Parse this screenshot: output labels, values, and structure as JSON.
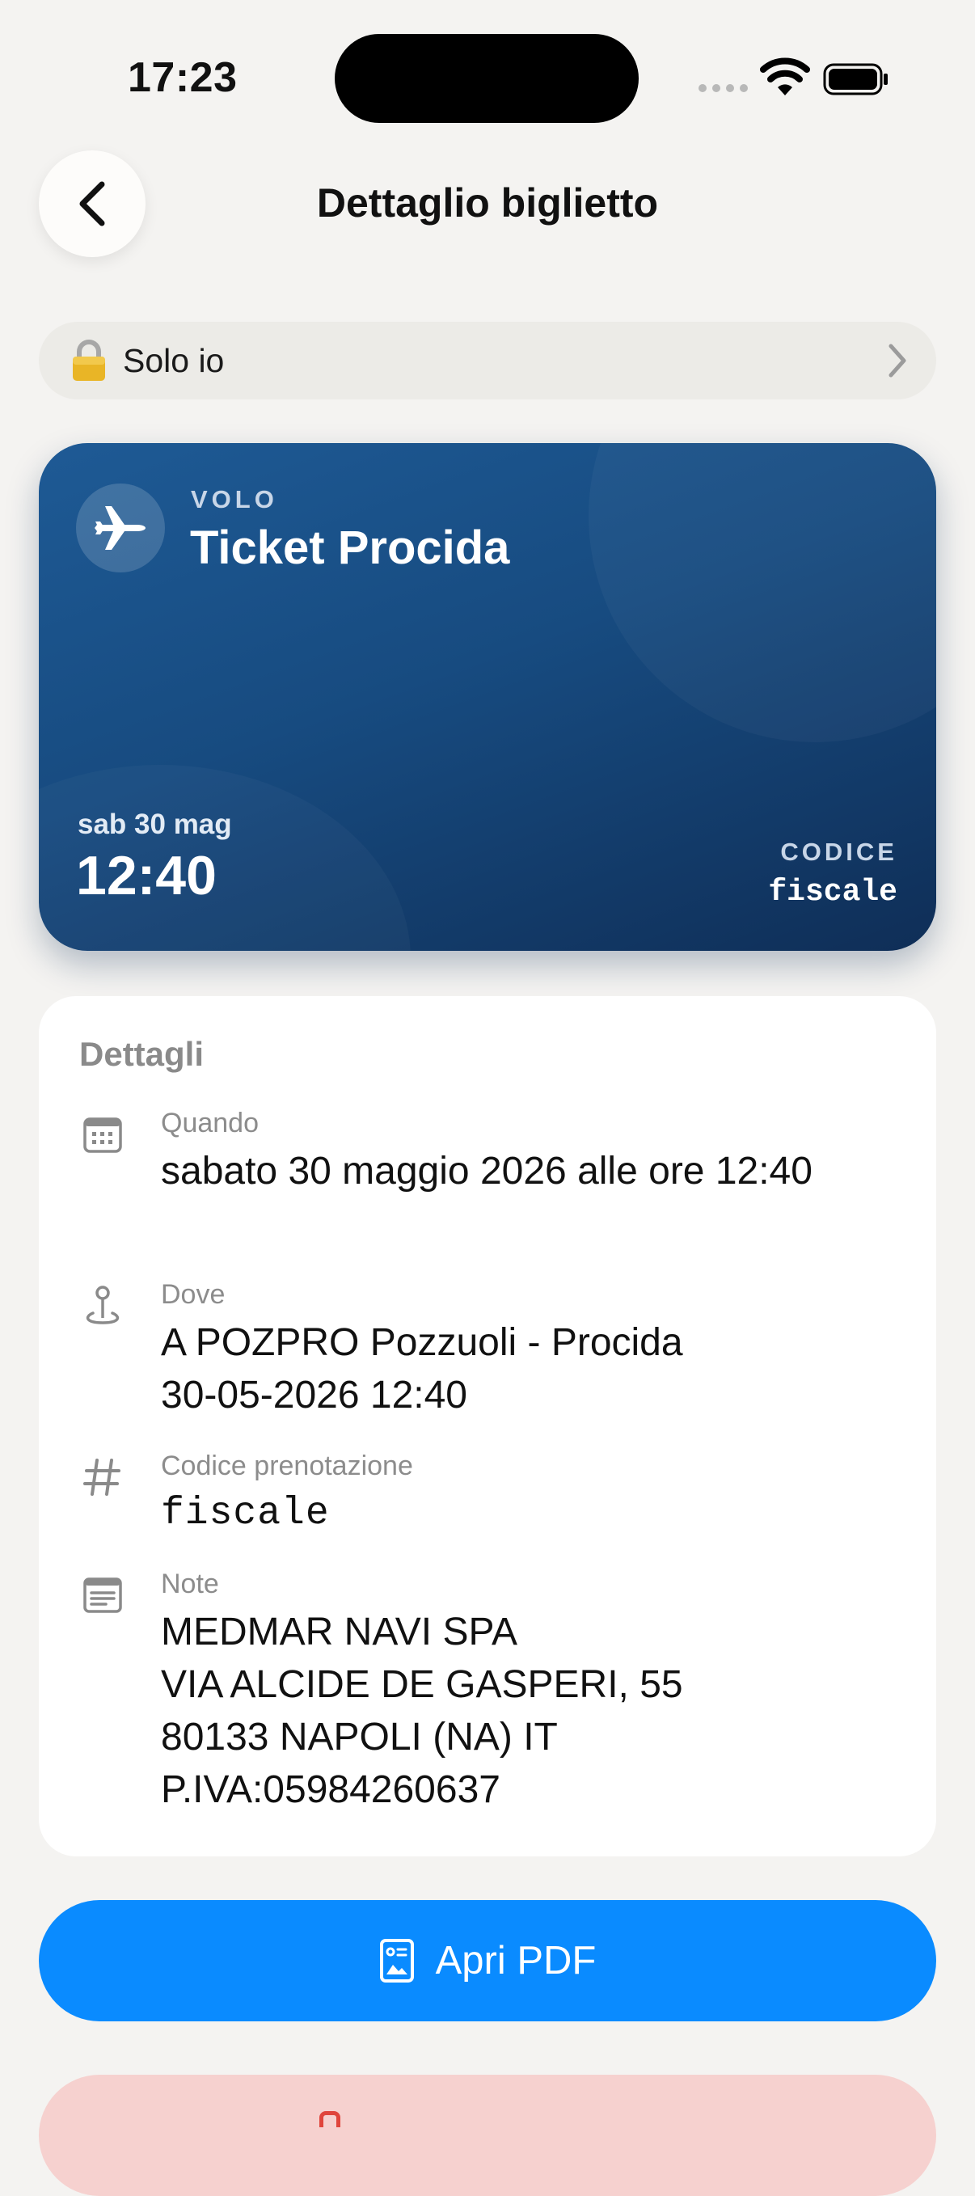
{
  "status_bar": {
    "time": "17:23"
  },
  "header": {
    "title": "Dettaglio biglietto"
  },
  "privacy": {
    "label": "Solo io"
  },
  "ticket": {
    "type": "VOLO",
    "name": "Ticket Procida",
    "date": "sab 30 mag",
    "time": "12:40",
    "code_label": "CODICE",
    "code": "fiscale"
  },
  "details": {
    "title": "Dettagli",
    "when": {
      "label": "Quando",
      "value": "sabato 30 maggio 2026 alle ore 12:40"
    },
    "where": {
      "label": "Dove",
      "line1": "A POZPRO Pozzuoli - Procida",
      "line2": "30-05-2026 12:40"
    },
    "booking": {
      "label": "Codice prenotazione",
      "value": "fiscale"
    },
    "notes": {
      "label": "Note",
      "line1": "MEDMAR NAVI SPA",
      "line2": "VIA ALCIDE DE GASPERI, 55",
      "line3": "80133 NAPOLI (NA) IT",
      "line4": "P.IVA:05984260637"
    }
  },
  "actions": {
    "open_pdf": "Apri PDF"
  },
  "icons": {
    "back": "chevron-left-icon",
    "lock": "lock-icon",
    "plane": "airplane-icon",
    "calendar": "calendar-icon",
    "location": "location-pin-icon",
    "hash": "hash-icon",
    "note": "note-icon",
    "pdf": "pdf-document-icon"
  },
  "colors": {
    "background": "#f4f3f1",
    "ticket_card": "#174b80",
    "primary_button": "#0a8bff",
    "danger_button": "#f6d1cf",
    "danger_accent": "#e0453c"
  }
}
